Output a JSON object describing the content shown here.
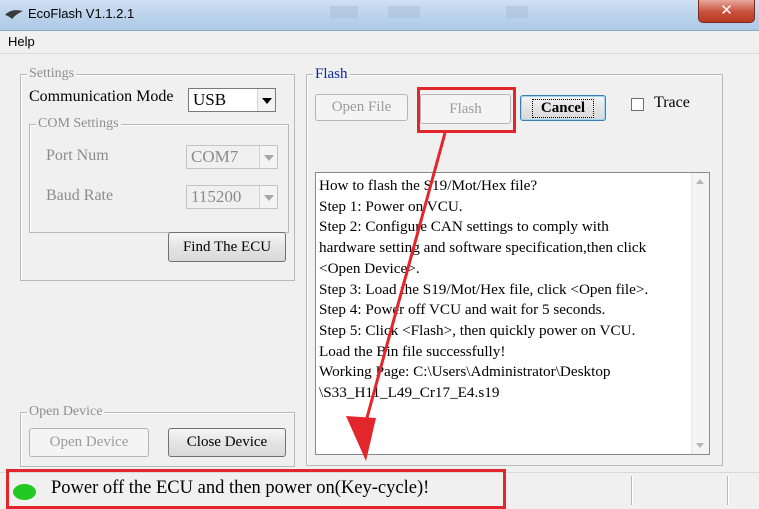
{
  "window": {
    "title": "EcoFlash V1.1.2.1"
  },
  "menu": {
    "help": "Help"
  },
  "settings": {
    "legend": "Settings",
    "comm_mode_label": "Communication Mode",
    "comm_mode_value": "USB",
    "com_settings_legend": "COM Settings",
    "port_num_label": "Port Num",
    "port_num_value": "COM7",
    "baud_rate_label": "Baud Rate",
    "baud_rate_value": "115200",
    "find_ecu_label": "Find The ECU"
  },
  "open_device": {
    "legend": "Open Device",
    "open_label": "Open Device",
    "close_label": "Close Device"
  },
  "flash": {
    "legend": "Flash",
    "open_file_label": "Open File",
    "flash_label": "Flash",
    "cancel_label": "Cancel",
    "trace_label": "Trace",
    "trace_checked": false,
    "log_lines": [
      "How to flash the S19/Mot/Hex file?",
      "Step 1: Power on VCU.",
      "Step 2: Configure CAN settings to comply with",
      "hardware setting and software specification,then click",
      "<Open Device>.",
      "Step 3: Load the S19/Mot/Hex file, click <Open file>.",
      "Step 4: Power off VCU and wait for 5 seconds.",
      "Step 5: Click <Flash>, then quickly power on VCU.",
      "Load the Bin file successfully!",
      "Working Page: C:\\Users\\Administrator\\Desktop",
      "\\S33_H11_L49_Cr17_E4.s19"
    ]
  },
  "status": {
    "message": "Power off the ECU and then power on(Key-cycle)!",
    "led_color": "#22c922"
  },
  "annotation": {
    "color": "#e3262b"
  }
}
